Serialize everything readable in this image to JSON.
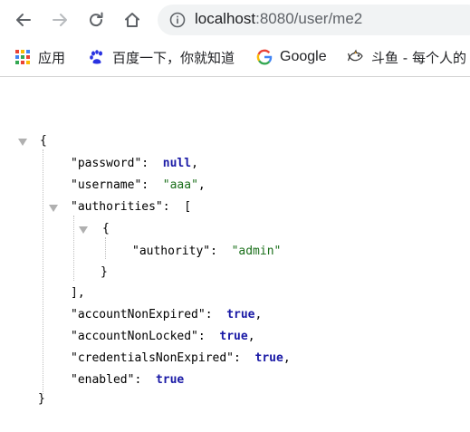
{
  "toolbar": {
    "back_icon": "back-arrow-icon",
    "forward_icon": "forward-arrow-icon",
    "reload_icon": "reload-icon",
    "home_icon": "home-icon",
    "url_host": "localhost",
    "url_rest": ":8080/user/me2"
  },
  "bookmarks": [
    {
      "label": "应用",
      "icon": "apps-grid-icon"
    },
    {
      "label": "百度一下，你就知道",
      "icon": "baidu-paw-icon"
    },
    {
      "label": "Google",
      "icon": "google-g-icon"
    },
    {
      "label": "斗鱼 - 每个人的",
      "icon": "douyu-fish-icon"
    }
  ],
  "json": {
    "open_brace": "{",
    "close_brace": "}",
    "password_key": "\"password\"",
    "password_value": "null",
    "username_key": "\"username\"",
    "username_value": "\"aaa\"",
    "authorities_key": "\"authorities\"",
    "array_open": "[",
    "array_close": "],",
    "item_open": "{",
    "item_close": "}",
    "authority_key": "\"authority\"",
    "authority_value": "\"admin\"",
    "accountNonExpired_key": "\"accountNonExpired\"",
    "accountNonExpired_value": "true",
    "accountNonLocked_key": "\"accountNonLocked\"",
    "accountNonLocked_value": "true",
    "credentialsNonExpired_key": "\"credentialsNonExpired\"",
    "credentialsNonExpired_value": "true",
    "enabled_key": "\"enabled\"",
    "enabled_value": "true",
    "colon": ":",
    "comma": ","
  },
  "colors": {
    "string": "#1a6f1a",
    "keyword": "#1a1aa6",
    "omnibox_bg": "#f1f3f4"
  }
}
